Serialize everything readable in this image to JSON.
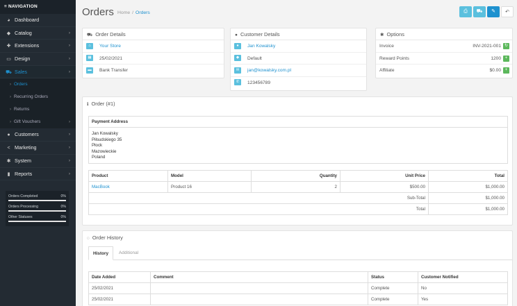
{
  "sidebar": {
    "header": "≡ NAVIGATION",
    "items": [
      {
        "label": "Dashboard",
        "icon": "dashboard-icon",
        "glyph": "◕"
      },
      {
        "label": "Catalog",
        "icon": "tag-icon",
        "glyph": "◆"
      },
      {
        "label": "Extensions",
        "icon": "puzzle-icon",
        "glyph": "✚"
      },
      {
        "label": "Design",
        "icon": "monitor-icon",
        "glyph": "▭"
      },
      {
        "label": "Sales",
        "icon": "cart-icon",
        "glyph": "⛟"
      }
    ],
    "sales_sub": [
      "Orders",
      "Recurring Orders",
      "Returns",
      "Gift Vouchers"
    ],
    "items_after": [
      {
        "label": "Customers",
        "icon": "user-icon",
        "glyph": "●"
      },
      {
        "label": "Marketing",
        "icon": "share-icon",
        "glyph": "<"
      },
      {
        "label": "System",
        "icon": "gear-icon",
        "glyph": "✱"
      },
      {
        "label": "Reports",
        "icon": "chart-icon",
        "glyph": "▮"
      }
    ],
    "stats": [
      {
        "label": "Orders Completed",
        "pct": "0%"
      },
      {
        "label": "Orders Processing",
        "pct": "0%"
      },
      {
        "label": "Other Statuses",
        "pct": "0%"
      }
    ]
  },
  "header": {
    "title": "Orders",
    "breadcrumb_home": "Home",
    "breadcrumb_sep": "/",
    "breadcrumb_current": "Orders"
  },
  "order_details": {
    "title": "Order Details",
    "store": "Your Store",
    "date": "25/02/2021",
    "payment": "Bank Transfer"
  },
  "customer_details": {
    "title": "Customer Details",
    "name": "Jan Kowalsky",
    "group": "Default",
    "email": "jan@kowalsky.com.pl",
    "phone": "123456789"
  },
  "options": {
    "title": "Options",
    "rows": [
      {
        "label": "Invoice",
        "value": "INV-2021-001"
      },
      {
        "label": "Reward Points",
        "value": "1200"
      },
      {
        "label": "Affiliate",
        "value": "$0.00"
      }
    ]
  },
  "order": {
    "title": "Order (#1)",
    "payment_address_title": "Payment Address",
    "address_lines": [
      "Jan Kowalsky",
      "Piłsudskiego 35",
      "Płock",
      "Mazowieckie",
      "Poland"
    ],
    "columns": {
      "product": "Product",
      "model": "Model",
      "quantity": "Quantity",
      "unit_price": "Unit Price",
      "total": "Total"
    },
    "product": {
      "name": "MacBook",
      "model": "Product 16",
      "quantity": "2",
      "unit_price": "$500.00",
      "total": "$1,000.00"
    },
    "subtotal_label": "Sub-Total",
    "subtotal": "$1,000.00",
    "total_label": "Total",
    "total": "$1,000.00"
  },
  "history": {
    "title": "Order History",
    "tabs": [
      "History",
      "Additional"
    ],
    "columns": {
      "date": "Date Added",
      "comment": "Comment",
      "status": "Status",
      "notified": "Customer Notified"
    },
    "rows": [
      {
        "date": "25/02/2021",
        "comment": "",
        "status": "Complete",
        "notified": "No"
      },
      {
        "date": "25/02/2021",
        "comment": "",
        "status": "Complete",
        "notified": "Yes"
      }
    ]
  },
  "colors": {
    "accent": "#1e91cf",
    "info": "#5bc0de",
    "success": "#5cb85c",
    "sidebar": "#232b33"
  }
}
